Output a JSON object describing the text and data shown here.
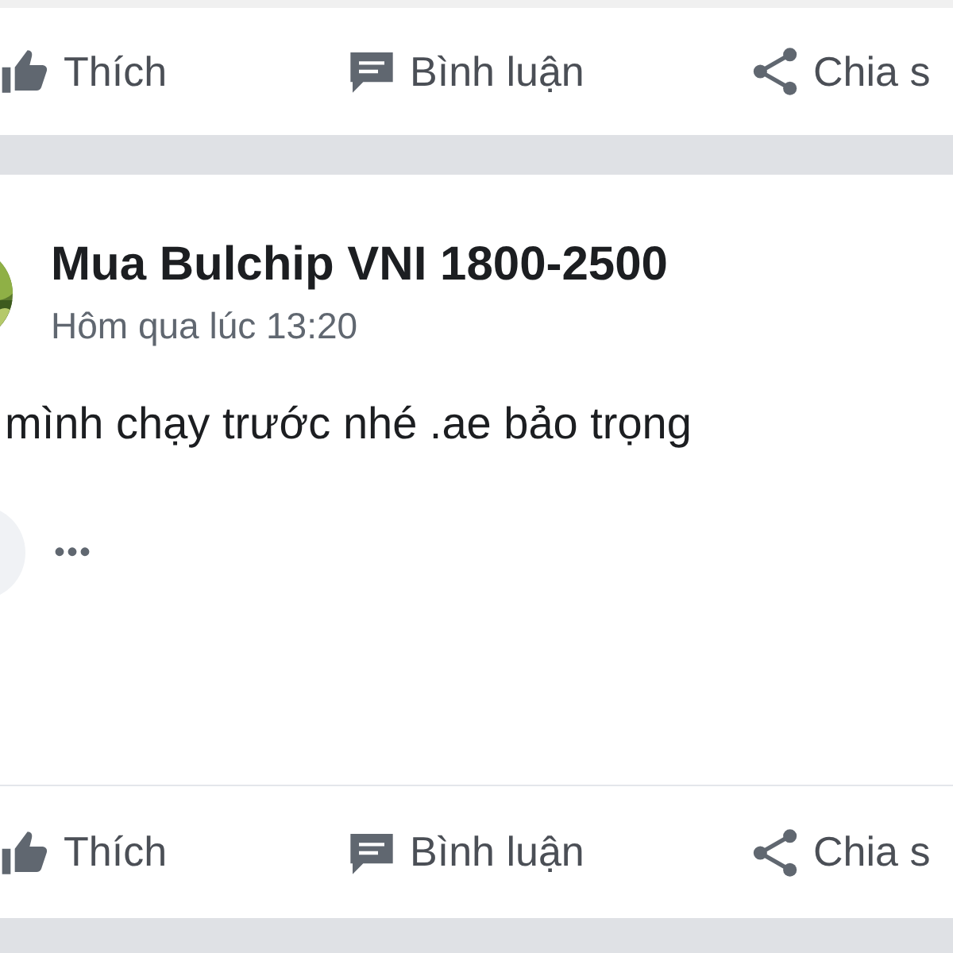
{
  "top_actions": [
    {
      "kind": "like",
      "label": "Thích"
    },
    {
      "kind": "comment",
      "label": "Bình luận"
    },
    {
      "kind": "share",
      "label": "Chia s"
    }
  ],
  "post": {
    "author": "Mua Bulchip VNI 1800-2500",
    "time": "Hôm qua lúc 13:20",
    "text": "mình chạy trước nhé .ae bảo trọng",
    "more": "•••"
  },
  "bottom_actions": [
    {
      "kind": "like",
      "label": "Thích"
    },
    {
      "kind": "comment",
      "label": "Bình luận"
    },
    {
      "kind": "share",
      "label": "Chia s"
    }
  ]
}
